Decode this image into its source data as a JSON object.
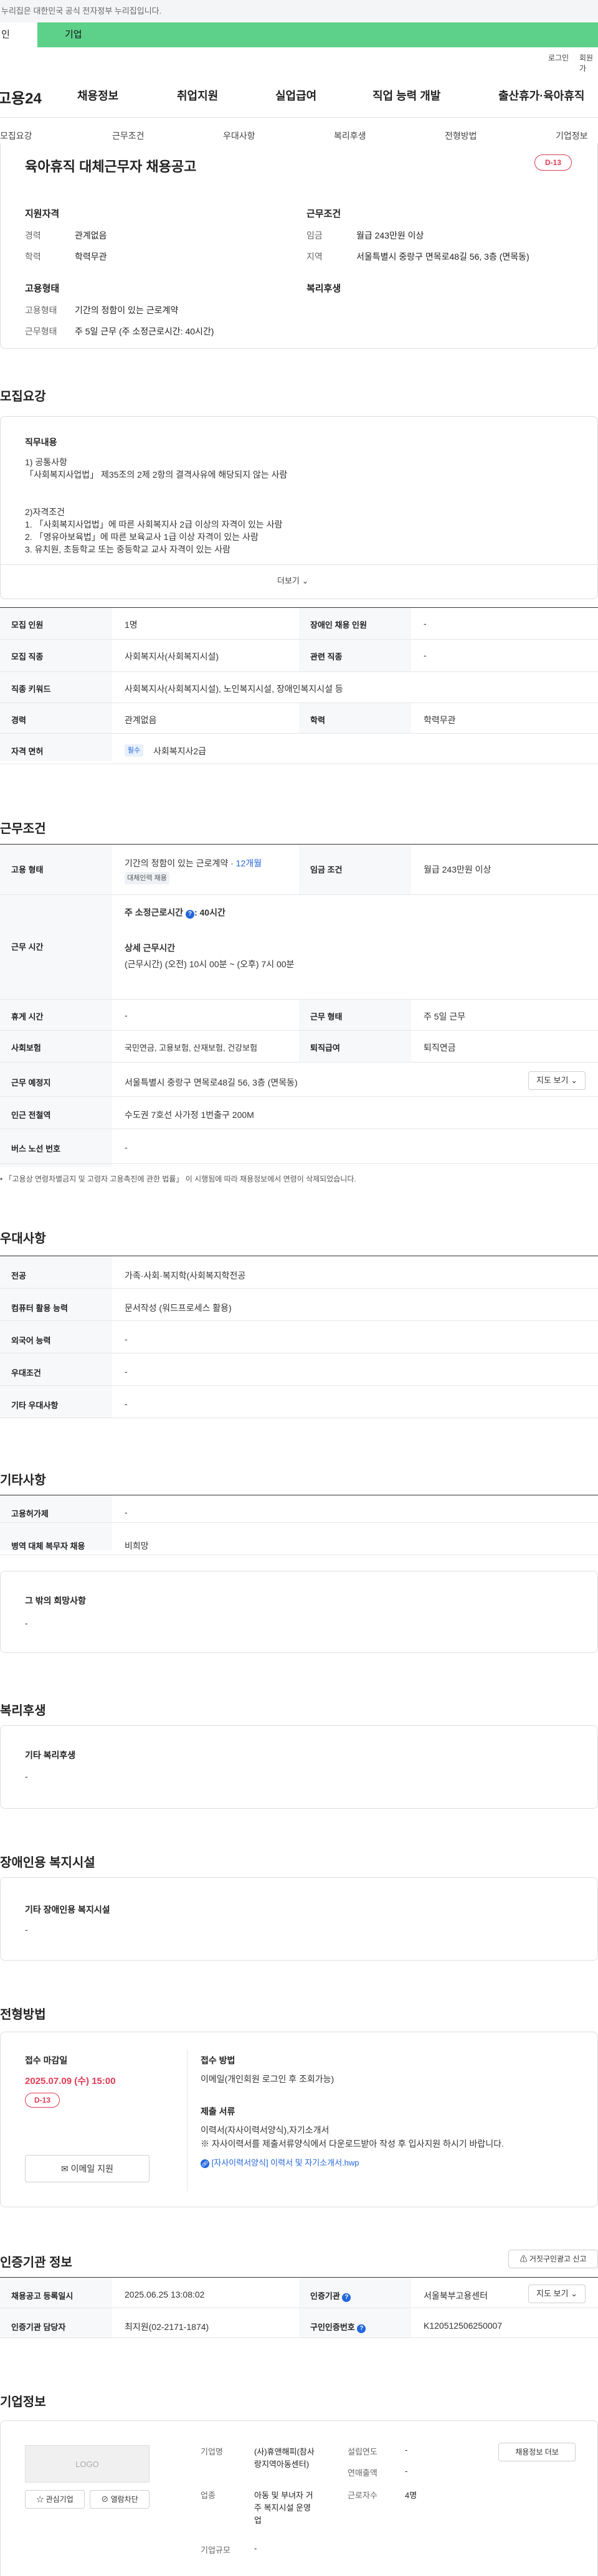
{
  "gov_notice": "누리집은 대한민국 공식 전자정부 누리집입니다.",
  "tabs": {
    "personal": "인",
    "corporate": "기업"
  },
  "util": {
    "login": "로그인",
    "signup": "회원가"
  },
  "site": {
    "logo": "고용24"
  },
  "gnb": [
    "채용정보",
    "취업지원",
    "실업급여",
    "직업 능력 개발",
    "출산휴가·육아휴직"
  ],
  "subnav": [
    "모집요강",
    "근무조건",
    "우대사항",
    "복리후생",
    "전형방법",
    "기업정보"
  ],
  "job": {
    "title": "육아휴직 대체근무자 채용공고",
    "dday": "D-13",
    "qual_h": "지원자격",
    "career_k": "경력",
    "career_v": "관계없음",
    "edu_k": "학력",
    "edu_v": "학력무관",
    "cond_h": "근무조건",
    "wage_k": "임금",
    "wage_v": "월급 243만원 이상",
    "region_k": "지역",
    "region_v": "서울특별시 중랑구 면목로48길 56, 3층 (면목동)",
    "emp_h": "고용형태",
    "emp_type_k": "고용형태",
    "emp_type_v": "기간의 정함이 있는 근로계약",
    "work_type_k": "근무형태",
    "work_type_v": "주 5일 근무 (주 소정근로시간: 40시간)",
    "welfare_h": "복리후생"
  },
  "recruit": {
    "heading": "모집요강",
    "duty_h": "직무내용",
    "lines": [
      "1) 공통사항",
      "「사회복지사업법」 제35조의 2제 2항의 결격사유에 해당되지 않는 사람",
      "",
      "",
      "2)자격조건",
      "1. 「사회복지사업법」에 따른 사회복지사 2급 이상의 자격이 있는 사람",
      "2. 「영유아보육법」에 따른 보육교사 1급 이상 자격이 있는 사람",
      "3. 유치원, 초등학교 또는 중등학교 교사 자격이 있는 사람"
    ],
    "more": "더보기",
    "rows": [
      [
        "모집 인원",
        "1명",
        "장애인 채용 인원",
        "-"
      ],
      [
        "모집 직종",
        "사회복지사(사회복지시설)",
        "관련 직종",
        "-"
      ]
    ],
    "keyword_k": "직종 키워드",
    "keyword_v": "사회복지사(사회복지시설), 노인복지시설, 장애인복지시설 등",
    "career_k": "경력",
    "career_v": "관계없음",
    "edu_k": "학력",
    "edu_v": "학력무관",
    "license_k": "자격 면허",
    "license_badge": "필수",
    "license_v": "사회복지사2급"
  },
  "work": {
    "heading": "근무조건",
    "emp_k": "고용 형태",
    "emp_v": "기간의 정함이 있는 근로계약 ·",
    "emp_months": "12개월",
    "emp_tag": "대체인력 채용",
    "wage_k": "임금 조건",
    "wage_v": "월급 243만원 이상",
    "hours_k": "근무 시간",
    "hours_std": "주 소정근로시간",
    "hours_std_v": ": 40시간",
    "hours_detail_h": "상세 근무시간",
    "hours_detail_v": "(근무시간) (오전) 10시 00분 ~ (오후) 7시 00분",
    "rest_k": "휴게 시간",
    "rest_v": "-",
    "form_k": "근무 형태",
    "form_v": "주 5일 근무",
    "ins_k": "사회보험",
    "ins_v": "국민연금, 고용보험, 산재보험, 건강보험",
    "sev_k": "퇴직급여",
    "sev_v": "퇴직연금",
    "place_k": "근무 예정지",
    "place_v": "서울특별시 중랑구 면목로48길 56, 3층 (면목동)",
    "map_btn": "지도 보기",
    "subway_k": "인근 전철역",
    "subway_v": "수도권 7호선 사가정 1번출구 200M",
    "bus_k": "버스 노선 번호",
    "bus_v": "-",
    "note": "「고용상 연령차별금지 및 고령자 고용촉진에 관한 법률」 이 시행됨에 따라 채용정보에서 연령이 삭제되었습니다."
  },
  "pref": {
    "heading": "우대사항",
    "rows": [
      [
        "전공",
        "가족·사회·복지학(사회복지학전공"
      ],
      [
        "컴퓨터 활용 능력",
        "문서작성 (워드프로세스 활용)"
      ],
      [
        "외국어 능력",
        "-"
      ],
      [
        "우대조건",
        "-"
      ],
      [
        "기타 우대사항",
        "-"
      ]
    ]
  },
  "etc": {
    "heading": "기타사항",
    "rows": [
      [
        "고용허가제",
        "-"
      ],
      [
        "병역 대체 복무자 채용",
        "비희망"
      ]
    ],
    "other_h": "그 밖의 희망사항",
    "other_v": "-"
  },
  "benefit": {
    "heading": "복리후생",
    "box_h": "기타 복리후생",
    "box_v": "-"
  },
  "disab": {
    "heading": "장애인용 복지시설",
    "box_h": "기타 장애인용 복지시설",
    "box_v": "-"
  },
  "selection": {
    "heading": "전형방법",
    "deadline_h": "접수 마감일",
    "deadline_v": "2025.07.09 (수) 15:00",
    "dday": "D-13",
    "email_btn": "이메일 지원",
    "method_h": "접수 방법",
    "method_v": "이메일(개인회원 로그인 후 조회가능)",
    "docs_h": "제출 서류",
    "docs_v1": "이력서(자사이력서양식),자기소개서",
    "docs_v2": "※ 자사이력서를 제출서류양식에서 다운로드받아 작성 후 입사지원 하시기 바랍니다.",
    "docs_link": "[자사이력서양식] 이력서 및 자기소개서.hwp"
  },
  "auth": {
    "heading": "인증기관 정보",
    "report_btn": "거짓구인광고 신고",
    "rows": [
      [
        "채용공고 등록일시",
        "2025.06.25 13:08:02",
        "인증기관",
        "서울북부고용센터"
      ],
      [
        "인증기관 담당자",
        "최지원(02-2171-1874)",
        "구인인증번호",
        "K120512506250007"
      ]
    ],
    "map_btn": "지도 보기"
  },
  "company": {
    "heading": "기업정보",
    "logo": "LOGO",
    "fav_btn": "관심기업",
    "block_btn": "열람차단",
    "name_k": "기업명",
    "name_v1": "(사)휴앤해피(참사",
    "name_v2": "랑지역아동센터)",
    "year_k": "설립연도",
    "year_v": "-",
    "sales_k": "연매출액",
    "sales_v": "-",
    "biz_k": "업종",
    "biz_v1": "아동 및 부녀자 거",
    "biz_v2": "주 복지시설 운영",
    "biz_v3": "업",
    "staff_k": "근로자수",
    "staff_v": "4명",
    "size_k": "기업규모",
    "size_v": "-",
    "list_btn": "채용정보 더보"
  }
}
